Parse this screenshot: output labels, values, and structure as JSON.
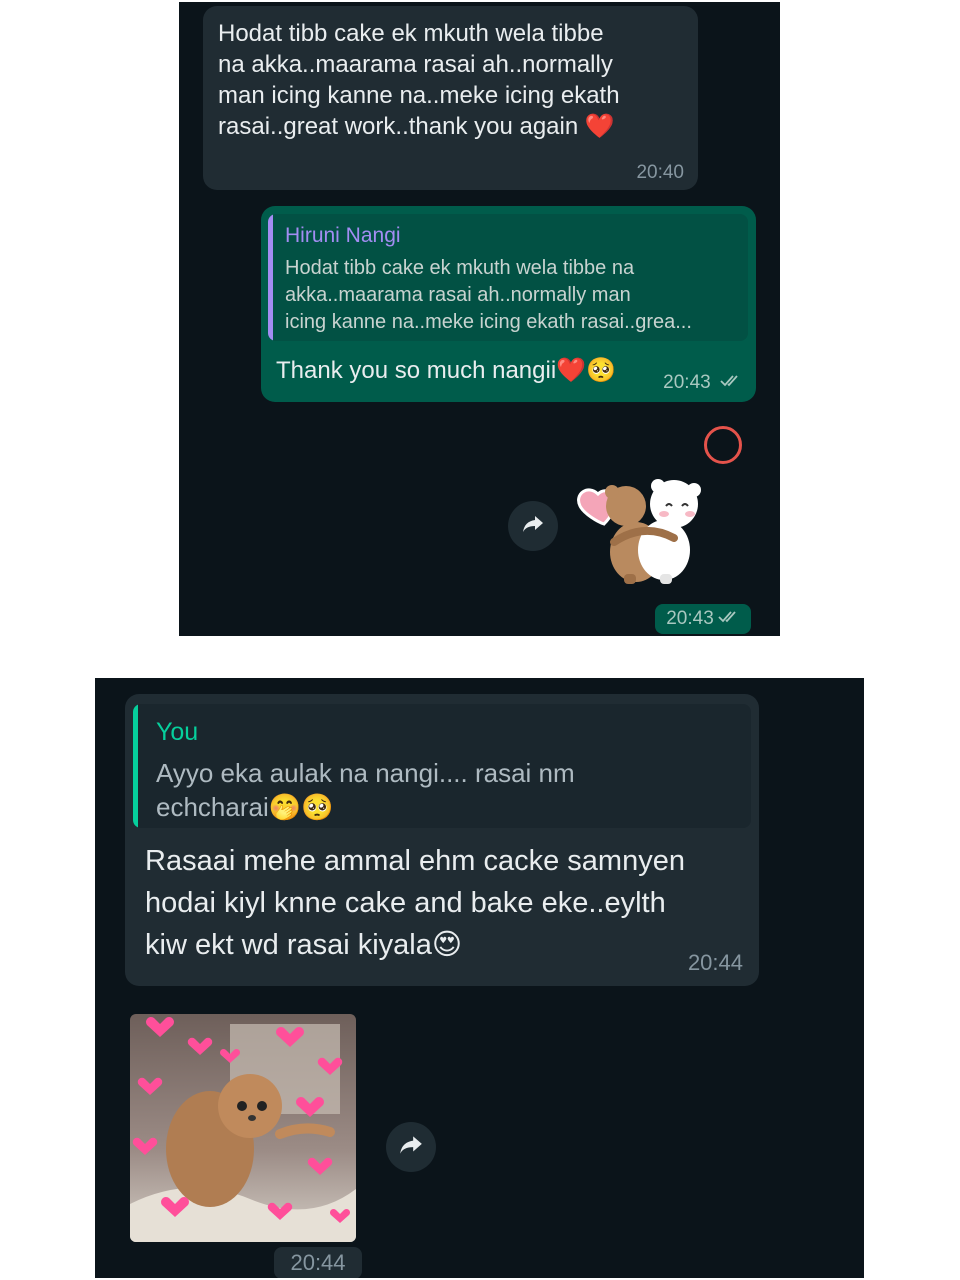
{
  "panel1": {
    "msg_in": {
      "text": "Hodat tibb cake ek mkuth wela tibbe\nna akka..maarama rasai ah..normally\nman icing kanne na..meke icing ekath\nrasai..great work..thank you again ❤️",
      "time": "20:40"
    },
    "msg_out": {
      "quote_name": "Hiruni Nangi",
      "quote_text": "Hodat tibb cake ek mkuth wela tibbe na\nakka..maarama rasai ah..normally man\nicing kanne na..meke icing ekath rasai..grea...",
      "text": "Thank you so much nangii❤️🥺",
      "time": "20:43"
    },
    "sticker": {
      "description": "bears-hug-sticker",
      "time": "20:43"
    }
  },
  "panel2": {
    "msg_in": {
      "quote_name": "You",
      "quote_text": "Ayyo eka aulak na nangi.... rasai nm\nechcharai🤭🥺",
      "text": "Rasaai mehe ammal ehm cacke samnyen\nhodai kiyl knne cake and bake eke..eylth\nkiw ekt wd rasai kiyala😍",
      "time": "20:44"
    },
    "image_msg": {
      "description": "cat-with-hearts-image",
      "time": "20:44"
    }
  },
  "colors": {
    "chat_bg": "#0b141a",
    "incoming": "#202c33",
    "outgoing": "#005c4b",
    "quote_name_purple": "#a38df2",
    "quote_name_green": "#06cf9c",
    "heart": "#e62e4d"
  }
}
